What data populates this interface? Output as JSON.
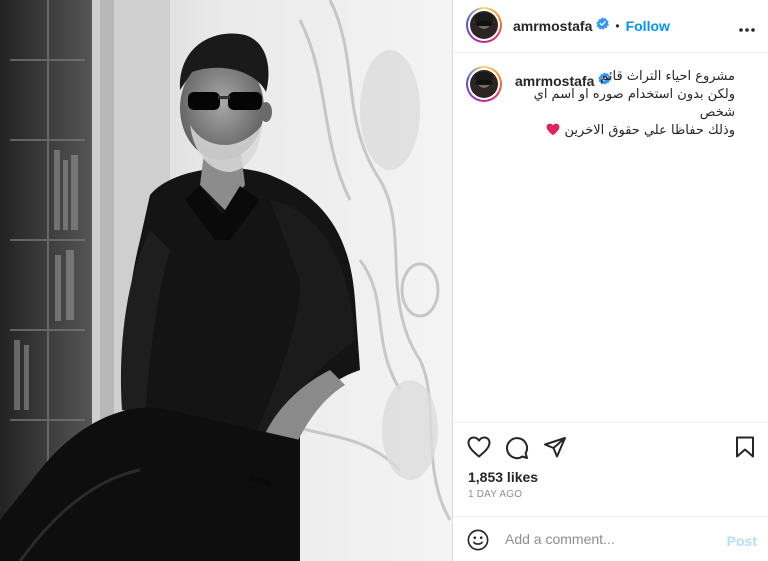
{
  "post": {
    "username": "amrmostafa",
    "verified": true,
    "follow_label": "Follow",
    "dot": "•"
  },
  "caption": {
    "lines": [
      "مشروع احياء التراث قائم",
      "ولكن بدون استخدام صوره او اسم اي",
      "شخص",
      "وذلك حفاظا علي حقوق الاخرين"
    ]
  },
  "stats": {
    "likes": "1,853 likes",
    "time": "1 DAY AGO"
  },
  "comment_box": {
    "placeholder": "Add a comment...",
    "post_label": "Post"
  },
  "icons": {
    "more": "more-options-icon",
    "like": "heart-outline-icon",
    "comment": "comment-bubble-icon",
    "share": "paper-plane-icon",
    "save": "bookmark-icon",
    "emoji": "smiley-icon",
    "verified": "verified-badge-icon",
    "caption_heart": "red-heart-emoji"
  },
  "colors": {
    "accent": "#0095f6",
    "post_disabled": "#b2dffc",
    "heart": "#e0245e"
  }
}
